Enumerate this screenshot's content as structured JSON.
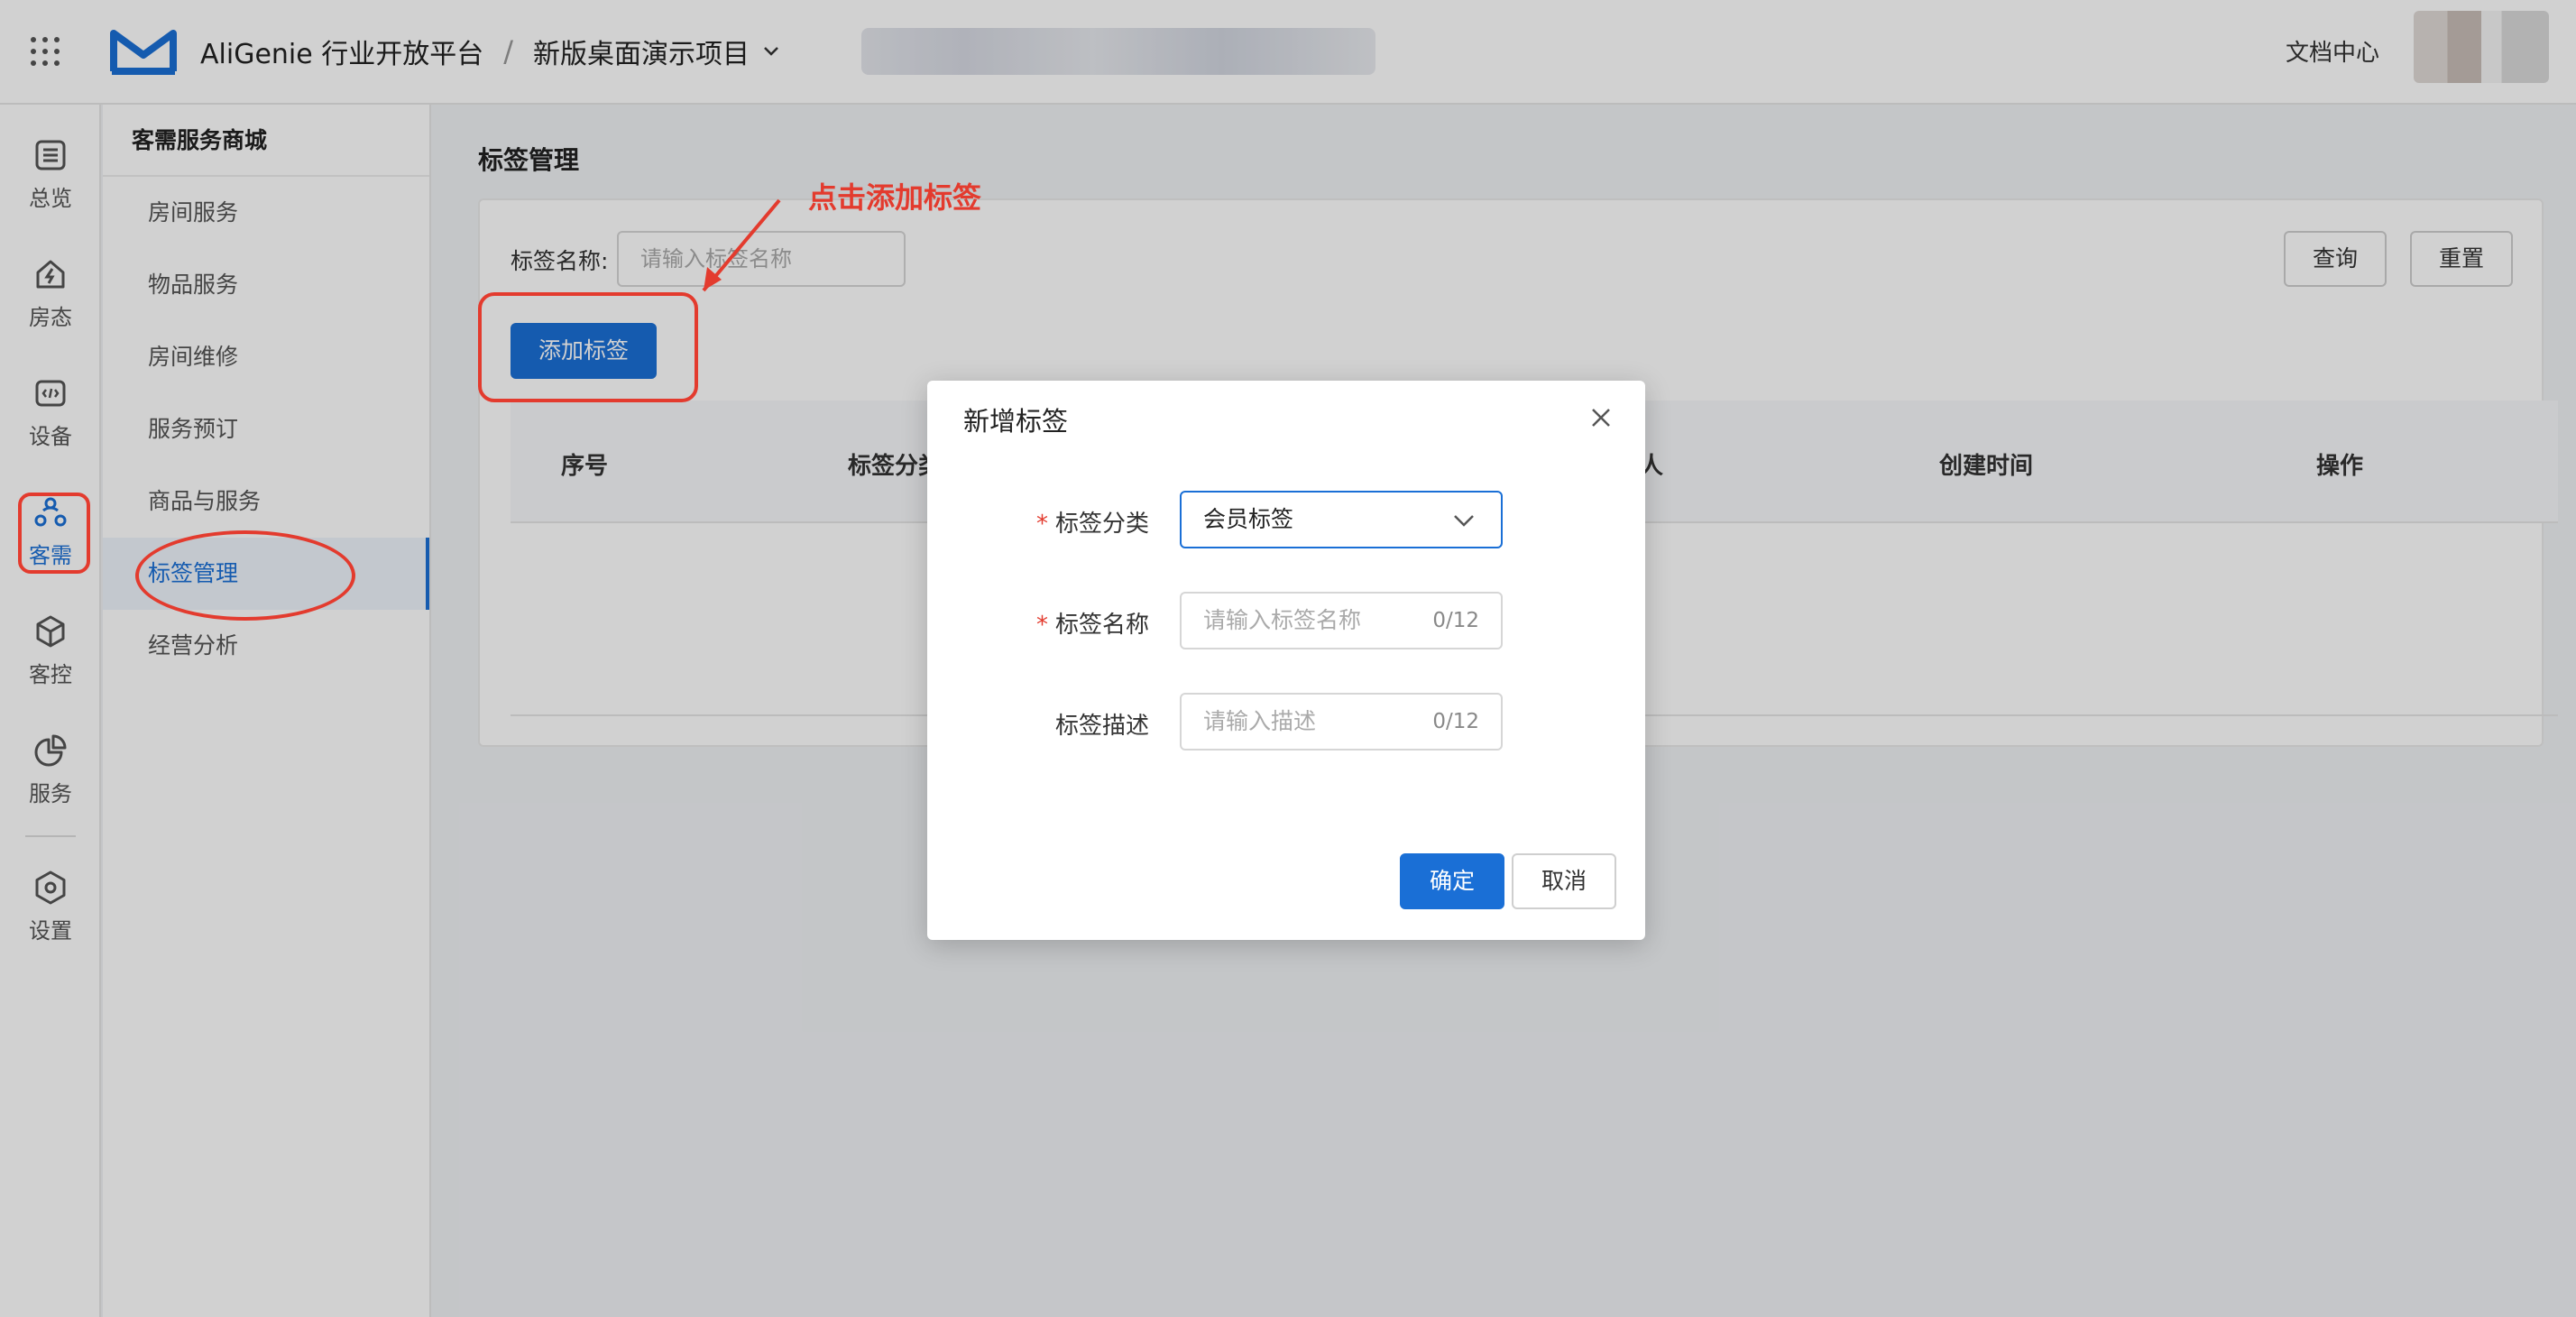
{
  "header": {
    "brand": "AliGenie 行业开放平台",
    "separator": "/",
    "project": "新版桌面演示项目",
    "doc_link": "文档中心"
  },
  "rail": {
    "items": [
      {
        "label": "总览",
        "icon": "list-icon"
      },
      {
        "label": "房态",
        "icon": "house-bolt-icon"
      },
      {
        "label": "设备",
        "icon": "code-box-icon"
      },
      {
        "label": "客需",
        "icon": "people-icon"
      },
      {
        "label": "客控",
        "icon": "cube-icon"
      },
      {
        "label": "服务",
        "icon": "pie-icon"
      },
      {
        "label": "设置",
        "icon": "hexagon-gear-icon"
      }
    ],
    "active": "客需"
  },
  "menu": {
    "title": "客需服务商城",
    "items": [
      "房间服务",
      "物品服务",
      "房间维修",
      "服务预订",
      "商品与服务",
      "标签管理",
      "经营分析"
    ],
    "active": "标签管理"
  },
  "main": {
    "page_title": "标签管理",
    "filter_label": "标签名称:",
    "filter_placeholder": "请输入标签名称",
    "query_button": "查询",
    "reset_button": "重置",
    "add_button": "添加标签",
    "columns": [
      "序号",
      "标签分类",
      "创建人",
      "创建时间",
      "操作"
    ]
  },
  "annotation": {
    "text": "点击添加标签",
    "color": "#e33b2e"
  },
  "modal": {
    "title": "新增标签",
    "fields": [
      {
        "label": "标签分类",
        "required": true,
        "value": "会员标签",
        "type": "select"
      },
      {
        "label": "标签名称",
        "required": true,
        "placeholder": "请输入标签名称",
        "count": "0/12"
      },
      {
        "label": "标签描述",
        "required": false,
        "placeholder": "请输入描述",
        "count": "0/12"
      }
    ],
    "ok_button": "确定",
    "cancel_button": "取消"
  },
  "colors": {
    "primary": "#1a6fd6",
    "annotation_red": "#e33b2e"
  }
}
